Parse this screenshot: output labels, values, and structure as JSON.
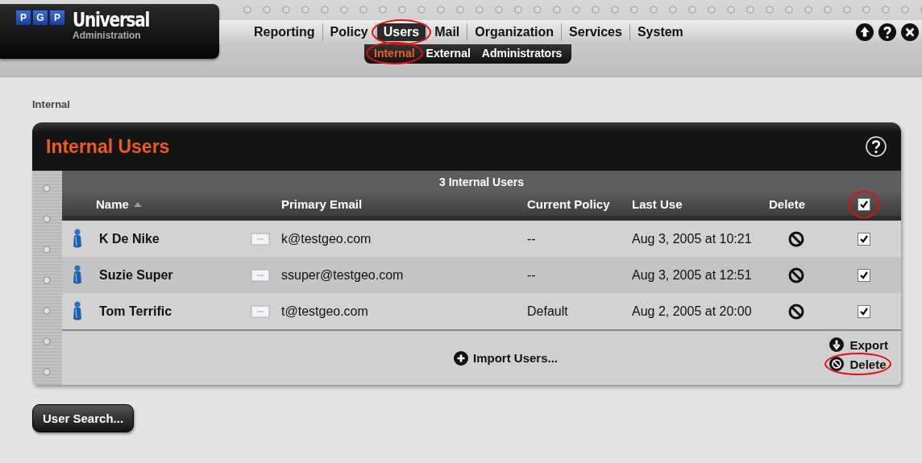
{
  "header": {
    "logo_letters": [
      "P",
      "G",
      "P"
    ],
    "product": "Universal",
    "subtitle": "Administration"
  },
  "nav": {
    "tabs": [
      {
        "label": "Reporting",
        "selected": false,
        "circled": false
      },
      {
        "label": "Policy",
        "selected": false,
        "circled": false
      },
      {
        "label": "Users",
        "selected": true,
        "circled": true
      },
      {
        "label": "Mail",
        "selected": false,
        "circled": false
      },
      {
        "label": "Organization",
        "selected": false,
        "circled": false
      },
      {
        "label": "Services",
        "selected": false,
        "circled": false
      },
      {
        "label": "System",
        "selected": false,
        "circled": false
      }
    ],
    "subtabs": [
      {
        "label": "Internal",
        "selected": true,
        "circled": true
      },
      {
        "label": "External",
        "selected": false,
        "circled": false
      },
      {
        "label": "Administrators",
        "selected": false,
        "circled": false
      }
    ]
  },
  "breadcrumb": "Internal",
  "panel": {
    "title": "Internal Users",
    "count": "3 Internal Users",
    "columns": [
      {
        "label": "Name",
        "sorted": true
      },
      {
        "label": "Primary Email",
        "sorted": false
      },
      {
        "label": "Current Policy",
        "sorted": false
      },
      {
        "label": "Last Use",
        "sorted": false
      },
      {
        "label": "Delete",
        "sorted": false
      }
    ],
    "select_all": {
      "checked": true,
      "circled": true
    },
    "rows": [
      {
        "name": "K De Nike",
        "email": "k@testgeo.com",
        "policy": "--",
        "last_use": "Aug 3, 2005 at 10:21",
        "checked": true
      },
      {
        "name": "Suzie Super",
        "email": "ssuper@testgeo.com",
        "policy": "--",
        "last_use": "Aug 3, 2005 at 12:51",
        "checked": true
      },
      {
        "name": "Tom Terrific",
        "email": "t@testgeo.com",
        "policy": "Default",
        "last_use": "Aug 2, 2005 at 20:00",
        "checked": true
      }
    ],
    "import": "Import Users...",
    "actions": [
      {
        "kind": "export",
        "label": "Export",
        "circled": false
      },
      {
        "kind": "delete",
        "label": "Delete",
        "circled": true
      }
    ]
  },
  "search_button": "User Search..."
}
